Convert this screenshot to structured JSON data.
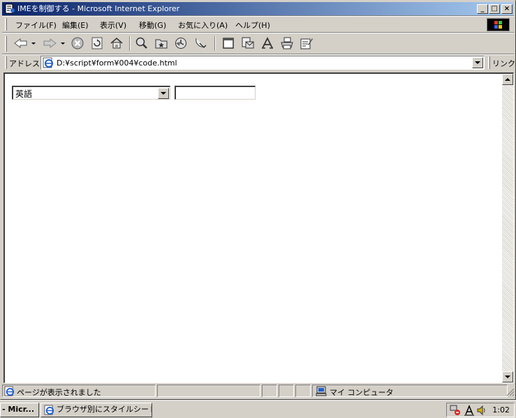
{
  "window": {
    "title": "IMEを制御する - Microsoft Internet Explorer",
    "controls": {
      "minimize": "_",
      "maximize": "□",
      "close": "×"
    }
  },
  "menubar": {
    "items": [
      "ファイル(F)",
      "編集(E)",
      "表示(V)",
      "移動(G)",
      "お気に入り(A)",
      "ヘルプ(H)"
    ]
  },
  "addressbar": {
    "label": "アドレス",
    "url": "D:¥script¥form¥004¥code.html",
    "links_label": "リンク"
  },
  "page": {
    "select_value": "英語",
    "text_value": ""
  },
  "statusbar": {
    "message": "ページが表示されました",
    "zone": "マイ コンピュータ"
  },
  "taskbar": {
    "start_label": "- Micr...",
    "task_label": "ブラウザ別にスタイルシートを...",
    "clock": "1:02"
  },
  "colors": {
    "title_start": "#0a246a",
    "title_end": "#a6caf0",
    "face": "#d4d0c8"
  }
}
